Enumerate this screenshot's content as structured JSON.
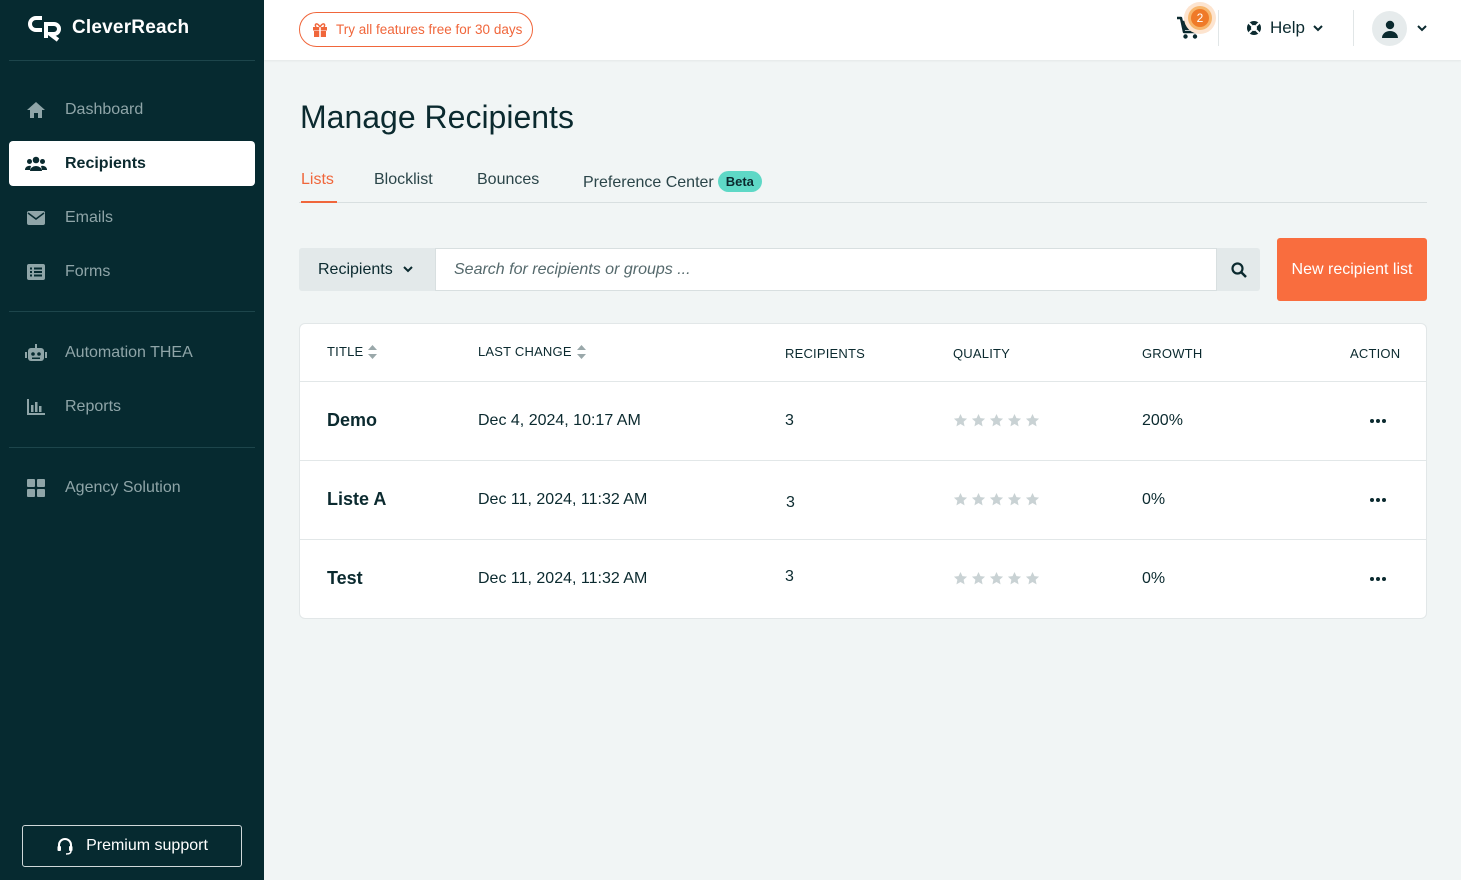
{
  "brand": {
    "name": "CleverReach"
  },
  "sidebar": {
    "items": [
      {
        "label": "Dashboard",
        "icon": "home-icon"
      },
      {
        "label": "Recipients",
        "icon": "users-icon",
        "active": true
      },
      {
        "label": "Emails",
        "icon": "envelope-icon"
      },
      {
        "label": "Forms",
        "icon": "form-icon"
      },
      {
        "label": "Automation THEA",
        "icon": "robot-icon"
      },
      {
        "label": "Reports",
        "icon": "bar-chart-icon"
      },
      {
        "label": "Agency Solution",
        "icon": "grid-icon"
      }
    ],
    "premium_support": "Premium support"
  },
  "topbar": {
    "trial_label": "Try all features free for 30 days",
    "cart_count": "2",
    "help_label": "Help"
  },
  "main": {
    "title": "Manage Recipients",
    "tabs": [
      {
        "label": "Lists",
        "active": true
      },
      {
        "label": "Blocklist"
      },
      {
        "label": "Bounces"
      },
      {
        "label": "Preference Center",
        "badge": "Beta"
      }
    ],
    "search": {
      "scope": "Recipients",
      "placeholder": "Search for recipients or groups ..."
    },
    "new_button": "New recipient list",
    "table": {
      "headers": {
        "title": "TITLE",
        "last_change": "LAST CHANGE",
        "recipients": "RECIPIENTS",
        "quality": "QUALITY",
        "growth": "GROWTH",
        "action": "ACTION"
      },
      "rows": [
        {
          "title": "Demo",
          "last_change": "Dec 4, 2024, 10:17 AM",
          "recipients": "3",
          "quality_stars": 0,
          "growth": "200%"
        },
        {
          "title": "Liste A",
          "last_change": "Dec 11, 2024, 11:32 AM",
          "recipients": "3",
          "quality_stars": 0,
          "growth": "0%"
        },
        {
          "title": "Test",
          "last_change": "Dec 11, 2024, 11:32 AM",
          "recipients": "3",
          "quality_stars": 0,
          "growth": "0%"
        }
      ]
    }
  },
  "colors": {
    "sidebar_bg": "#062a30",
    "accent": "#f96d3e",
    "beta_badge": "#5ed8c6",
    "star_empty": "#c9d2d4"
  }
}
